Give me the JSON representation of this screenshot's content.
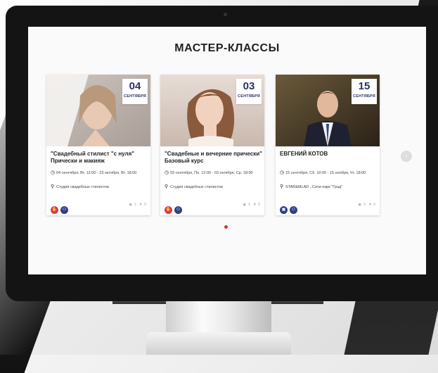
{
  "section": {
    "title": "МАСТЕР-КЛАССЫ"
  },
  "cards": [
    {
      "day": "04",
      "month": "СЕНТЯБРЯ",
      "title": "\"Свадебный стилист \"с нуля\" Прически и макияж",
      "schedule": "04 сентября, Вт. 12:00 - 23 октября, Вт. 18:00",
      "location": "Студия свадебных стилистов",
      "badges": [
        "hand-icon",
        "users-icon"
      ],
      "views": "1",
      "likes": "0"
    },
    {
      "day": "03",
      "month": "СЕНТЯБРЯ",
      "title": "\"Свадебные и вечерние прически\" Базовый курс",
      "schedule": "03 сентября, Пн. 12:00 - 03 октября, Ср. 18:00",
      "location": "Студия свадебных стилистов",
      "badges": [
        "hand-icon",
        "users-icon"
      ],
      "views": "0",
      "likes": "0"
    },
    {
      "day": "15",
      "month": "СЕНТЯБРЯ",
      "title": "ЕВГЕНИЙ КОТОВ",
      "schedule": "15 сентября, Сб. 10:00 - 15 ноября, Чт. 18:00",
      "location": "STAR&MLAD , Сити-парк \"Град\"",
      "badges": [
        "briefcase-icon",
        "users-icon"
      ],
      "views": "3",
      "likes": "0"
    }
  ],
  "icons": {
    "clock": "clock-icon",
    "location": "map-pin-icon",
    "views": "eye-icon",
    "likes": "heart-icon",
    "next": "chevron-right-icon"
  },
  "colors": {
    "accent_blue": "#24326f",
    "badge_red": "#d83b4d",
    "badge_blue": "#2e3f86",
    "pagination_dot": "#d33333"
  },
  "pagination": {
    "active_index": 0,
    "count": 1
  }
}
